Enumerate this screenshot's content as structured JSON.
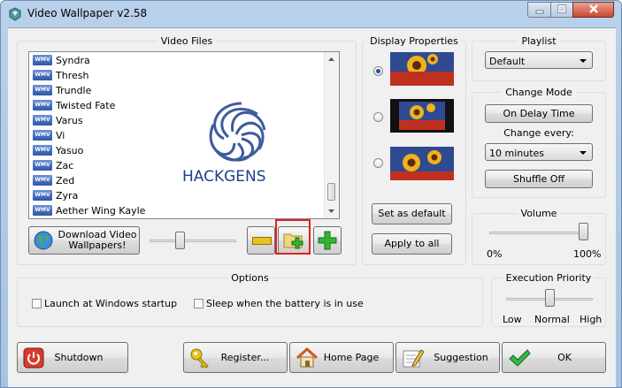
{
  "window": {
    "title": "Video Wallpaper  v2.58"
  },
  "video_files": {
    "title": "Video Files",
    "items": [
      {
        "badge": "WMV",
        "name": "Syndra"
      },
      {
        "badge": "WMV",
        "name": "Thresh"
      },
      {
        "badge": "WMV",
        "name": "Trundle"
      },
      {
        "badge": "WMV",
        "name": "Twisted Fate"
      },
      {
        "badge": "WMV",
        "name": "Varus"
      },
      {
        "badge": "WMV",
        "name": "Vi"
      },
      {
        "badge": "WMV",
        "name": "Yasuo"
      },
      {
        "badge": "WMV",
        "name": "Zac"
      },
      {
        "badge": "WMV",
        "name": "Zed"
      },
      {
        "badge": "WMV",
        "name": "Zyra"
      },
      {
        "badge": "WMV",
        "name": "Aether Wing Kayle"
      }
    ],
    "watermark": "HACKGENS",
    "download_button": "Download Video\nWallpapers!"
  },
  "display_properties": {
    "title": "Display Properties",
    "selected_index": 0,
    "set_default": "Set as default",
    "apply_all": "Apply to all"
  },
  "playlist": {
    "title": "Playlist",
    "value": "Default"
  },
  "change_mode": {
    "title": "Change Mode",
    "mode_button": "On Delay Time",
    "every_label": "Change every:",
    "every_value": "10 minutes",
    "shuffle_button": "Shuffle Off"
  },
  "volume": {
    "title": "Volume",
    "min_label": "0%",
    "max_label": "100%",
    "level": 1.0
  },
  "options": {
    "title": "Options",
    "launch_startup": "Launch at Windows startup",
    "sleep_battery": "Sleep when the battery is in use"
  },
  "priority": {
    "title": "Execution Priority",
    "low": "Low",
    "normal": "Normal",
    "high": "High",
    "level": 0.5
  },
  "bottom": {
    "shutdown": "Shutdown",
    "register": "Register...",
    "home": "Home Page",
    "suggestion": "Suggestion",
    "ok": "OK"
  },
  "colors": {
    "accent": "#1b52a8",
    "add_green": "#2fb82f",
    "remove_yellow": "#e8c21a",
    "highlight_red": "#e02020"
  }
}
